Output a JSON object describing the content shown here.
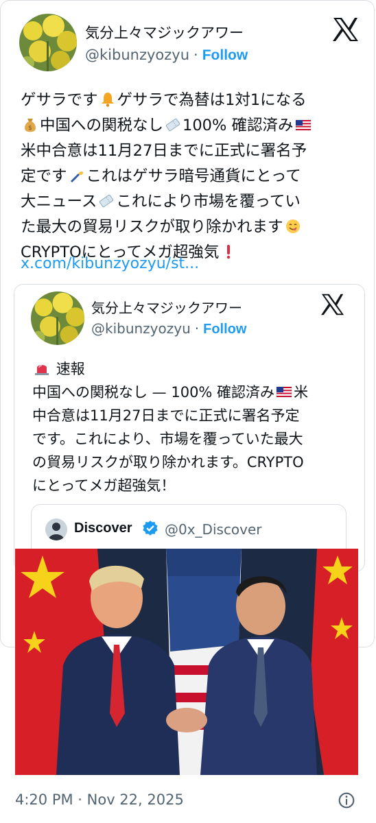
{
  "post": {
    "display_name": "気分上々マジックアワー",
    "handle": "@kibunzyozyu",
    "separator": "·",
    "follow_label": "Follow",
    "text_lines": [
      [
        "ゲサラです",
        "bell",
        "ゲサラで為替は1対1になる"
      ],
      [
        "",
        "money-bag",
        "中国への関税なし",
        "ticket",
        "100% 確認済み",
        "us-flag"
      ],
      [
        "米中合意は11月27日までに正式に署名予"
      ],
      [
        "定です",
        "writing-hand",
        "これはゲサラ暗号通貨にとって"
      ],
      [
        "大ニュース",
        "ticket",
        "これにより市場を覆ってい"
      ],
      [
        "た最大の貿易リスクが取り除かれます",
        "yum-face"
      ],
      [
        "CRYPTOにとってメガ超強気",
        "exclamation"
      ]
    ],
    "link": "x.com/kibunzyozyu/st..."
  },
  "quoted_post": {
    "display_name": "気分上々マジックアワー",
    "handle": "@kibunzyozyu",
    "separator": "·",
    "follow_label": "Follow",
    "headline": "速報",
    "body_lines": [
      "中国への関税なし — 100% 確認済み",
      "中合意は11月27日までに正式に署名予定",
      "です。これにより、市場を覆っていた最大",
      "の貿易リスクが取り除かれます。CRYPTO",
      "にとってメガ超強気！"
    ],
    "line1_tail": "米"
  },
  "nested_quote": {
    "display_name": "Discover",
    "handle": "@0x_Discover"
  },
  "timestamp": "4:20 PM · Nov 22, 2025",
  "colors": {
    "link_blue": "#1d9bf0",
    "secondary_text": "#536471",
    "border": "#d8dde2"
  }
}
